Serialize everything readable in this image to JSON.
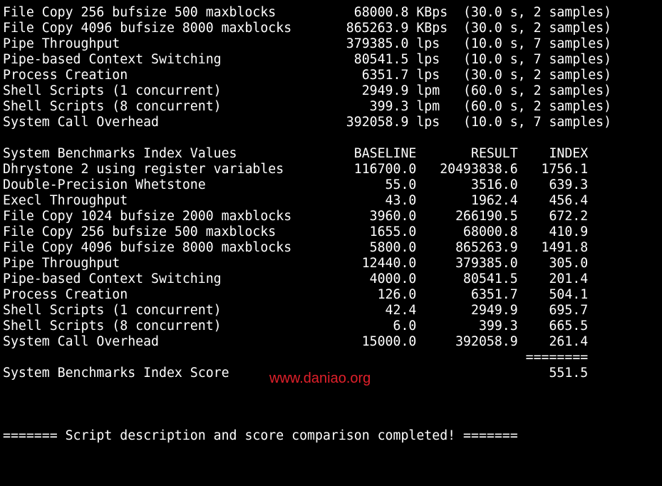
{
  "terminal": {
    "background": "#000000",
    "text_color": "#ffffff",
    "lines": [
      "File Copy 256 bufsize 500 maxblocks          68000.8 KBps  (30.0 s, 2 samples)",
      "File Copy 4096 bufsize 8000 maxblocks       865263.9 KBps  (30.0 s, 2 samples)",
      "Pipe Throughput                             379385.0 lps   (10.0 s, 7 samples)",
      "Pipe-based Context Switching                 80541.5 lps   (10.0 s, 7 samples)",
      "Process Creation                              6351.7 lps   (30.0 s, 2 samples)",
      "Shell Scripts (1 concurrent)                  2949.9 lpm   (60.0 s, 2 samples)",
      "Shell Scripts (8 concurrent)                   399.3 lpm   (60.0 s, 2 samples)",
      "System Call Overhead                        392058.9 lps   (10.0 s, 7 samples)",
      "",
      "System Benchmarks Index Values               BASELINE       RESULT    INDEX",
      "Dhrystone 2 using register variables         116700.0   20493838.6   1756.1",
      "Double-Precision Whetstone                       55.0       3516.0    639.3",
      "Execl Throughput                                 43.0       1962.4    456.4",
      "File Copy 1024 bufsize 2000 maxblocks          3960.0     266190.5    672.2",
      "File Copy 256 bufsize 500 maxblocks            1655.0      68000.8    410.9",
      "File Copy 4096 bufsize 8000 maxblocks          5800.0     865263.9   1491.8",
      "Pipe Throughput                               12440.0     379385.0    305.0",
      "Pipe-based Context Switching                   4000.0      80541.5    201.4",
      "Process Creation                                126.0       6351.7    504.1",
      "Shell Scripts (1 concurrent)                     42.4       2949.9    695.7",
      "Shell Scripts (8 concurrent)                      6.0        399.3    665.5",
      "System Call Overhead                          15000.0     392058.9    261.4",
      "                                                                   ========",
      "System Benchmarks Index Score                                         551.5",
      "",
      "",
      "",
      "======= Script description and score comparison completed! ======="
    ]
  },
  "watermark": {
    "text": "www.daniao.org",
    "color": "#e0202a"
  }
}
